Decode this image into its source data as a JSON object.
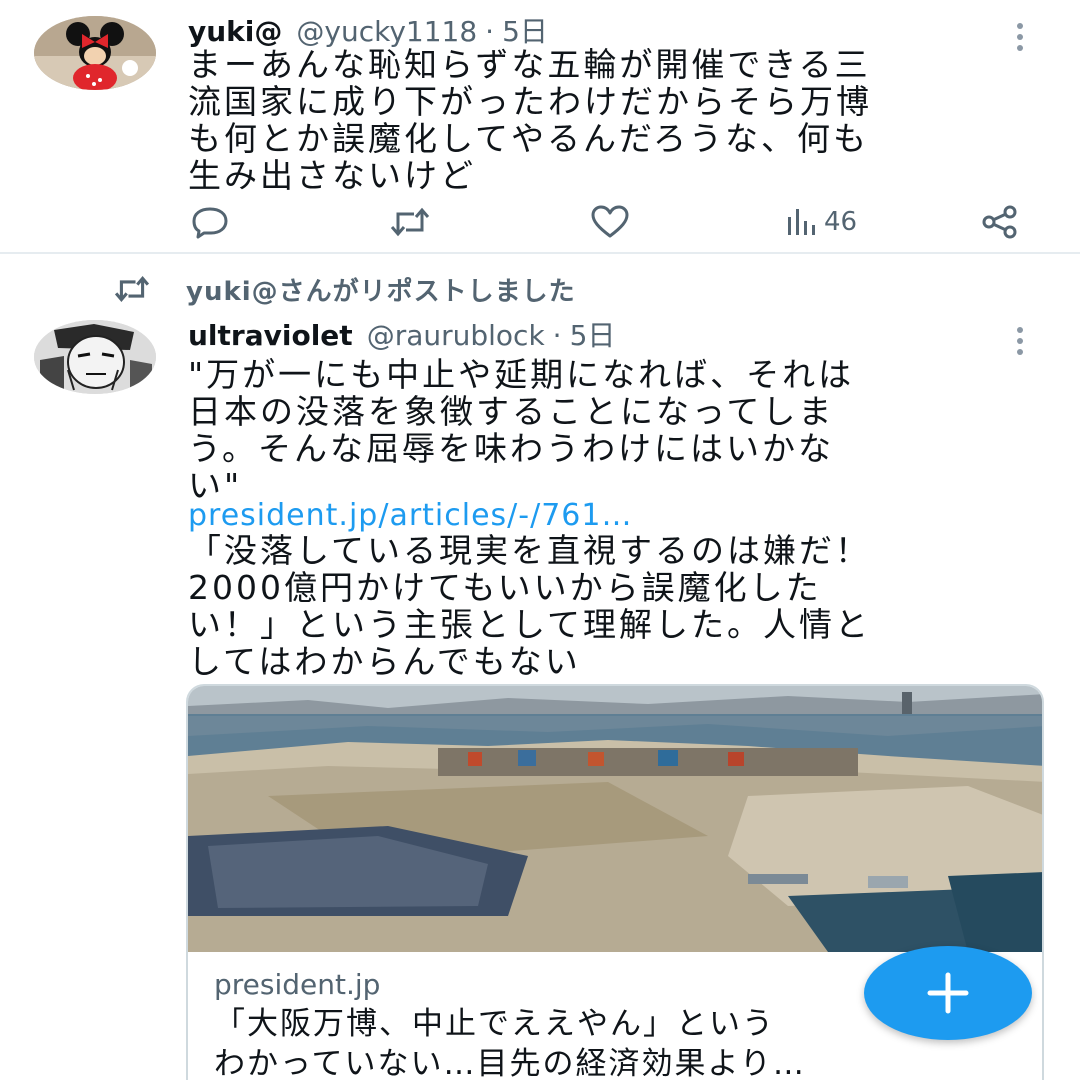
{
  "tweet1": {
    "name": "yuki@",
    "handle": "@yucky1118",
    "separator": "·",
    "time": "5日",
    "text": "まーあんな恥知らずな五輪が開催できる三\n流国家に成り下がったわけだからそら万博\nも何とか誤魔化してやるんだろうな、何も\n生み出さないけど",
    "views": "46",
    "avatar_icon": "minnie-mouse-avatar"
  },
  "repost_note": {
    "text": "yuki@さんがリポストしました",
    "icon": "retweet-icon"
  },
  "tweet2": {
    "name": "ultraviolet",
    "handle": "@raurublock",
    "separator": "·",
    "time": "5日",
    "quote": "\"万が一にも中止や延期になれば、それは\n日本の没落を象徴することになってしま\nう。そんな屈辱を味わうわけにはいかな\nい\"",
    "link": "president.jp/articles/-/761…",
    "comment": "「没落している現実を直視するのは嫌だ！\n2000億円かけてもいいから誤魔化した\nい！」という主張として理解した。人情と\nしてはわからんでもない",
    "avatar_icon": "manga-character-avatar"
  },
  "card": {
    "domain": "president.jp",
    "title": "「大阪万博、中止でええやん」という\nわかっていない…目先の経済効果より…",
    "image": "aerial-photo-of-yumeshima-construction-site"
  },
  "colors": {
    "accent": "#1d9bf0",
    "secondary_text": "#536471",
    "divider": "#e6ecf0"
  }
}
